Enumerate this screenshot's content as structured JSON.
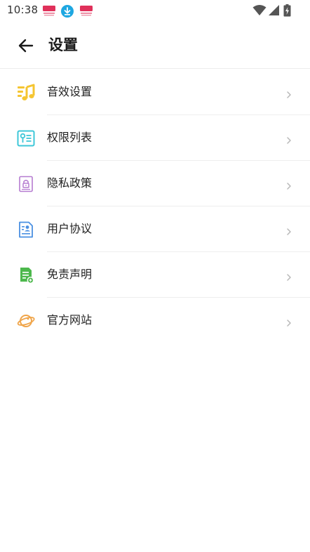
{
  "status_bar": {
    "time": "10:38",
    "notification_icons": [
      "app-notification-icon",
      "download-icon",
      "app-notification-icon"
    ],
    "system_icons": [
      "wifi-icon",
      "cell-signal-icon",
      "battery-charging-icon"
    ]
  },
  "header": {
    "title": "设置",
    "back_icon": "arrow-left-icon"
  },
  "menu": {
    "items": [
      {
        "label": "音效设置",
        "icon": "music-note-icon",
        "icon_color": "#F5C531"
      },
      {
        "label": "权限列表",
        "icon": "permission-list-icon",
        "icon_color": "#3EC7D8"
      },
      {
        "label": "隐私政策",
        "icon": "privacy-lock-icon",
        "icon_color": "#B57BD0"
      },
      {
        "label": "用户协议",
        "icon": "user-agreement-icon",
        "icon_color": "#4A90E2"
      },
      {
        "label": "免责声明",
        "icon": "disclaimer-document-icon",
        "icon_color": "#4CB84C"
      },
      {
        "label": "官方网站",
        "icon": "planet-icon",
        "icon_color": "#F0A54A"
      }
    ]
  },
  "colors": {
    "chevron": "#b8b8b8",
    "download_badge": "#1EA7E1",
    "app_badge": "#E0305A"
  }
}
